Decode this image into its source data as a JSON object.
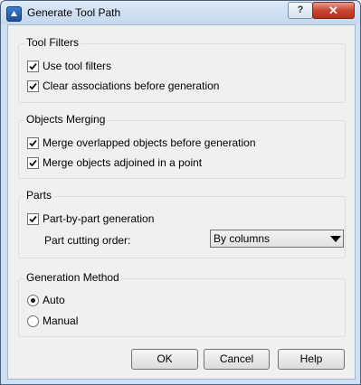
{
  "window": {
    "title": "Generate Tool Path",
    "help_label": "?",
    "close_label": "✕"
  },
  "tool_filters": {
    "legend": "Tool Filters",
    "use_tool_filters": {
      "label": "Use tool filters",
      "checked": true
    },
    "clear_associations": {
      "label": "Clear associations before generation",
      "checked": true
    }
  },
  "objects_merging": {
    "legend": "Objects Merging",
    "merge_overlapped": {
      "label": "Merge overlapped objects before generation",
      "checked": true
    },
    "merge_adjoined": {
      "label": "Merge objects adjoined in a point",
      "checked": true
    }
  },
  "parts": {
    "legend": "Parts",
    "part_by_part": {
      "label": "Part-by-part generation",
      "checked": true
    },
    "cutting_order_label": "Part cutting order:",
    "cutting_order_value": "By columns"
  },
  "generation_method": {
    "legend": "Generation Method",
    "auto_label": "Auto",
    "manual_label": "Manual",
    "selected": "Auto"
  },
  "buttons": {
    "ok": "OK",
    "cancel": "Cancel",
    "help": "Help"
  }
}
